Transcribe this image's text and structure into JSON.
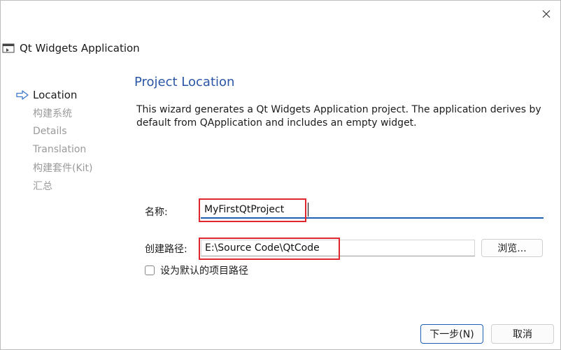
{
  "window": {
    "title": "Qt Widgets Application",
    "close_icon": "close-icon"
  },
  "steps": [
    {
      "label": "Location",
      "active": true
    },
    {
      "label": "构建系统",
      "active": false
    },
    {
      "label": "Details",
      "active": false
    },
    {
      "label": "Translation",
      "active": false
    },
    {
      "label": "构建套件(Kit)",
      "active": false
    },
    {
      "label": "汇总",
      "active": false
    }
  ],
  "page": {
    "title": "Project Location",
    "description": "This wizard generates a Qt Widgets Application project. The application derives by default from QApplication and includes an empty widget."
  },
  "form": {
    "name_label": "名称:",
    "name_value": "MyFirstQtProject",
    "path_label": "创建路径:",
    "path_value": "E:\\Source Code\\QtCode",
    "browse_label": "浏览...",
    "default_path_checkbox": {
      "label": "设为默认的项目路径",
      "checked": false
    }
  },
  "buttons": {
    "next_label": "下一步(N)",
    "cancel_label": "取消"
  },
  "colors": {
    "accent": "#1e60b4",
    "title_blue": "#2a56a5",
    "highlight_red": "#e0262e",
    "arrow_blue": "#3d78c9"
  }
}
